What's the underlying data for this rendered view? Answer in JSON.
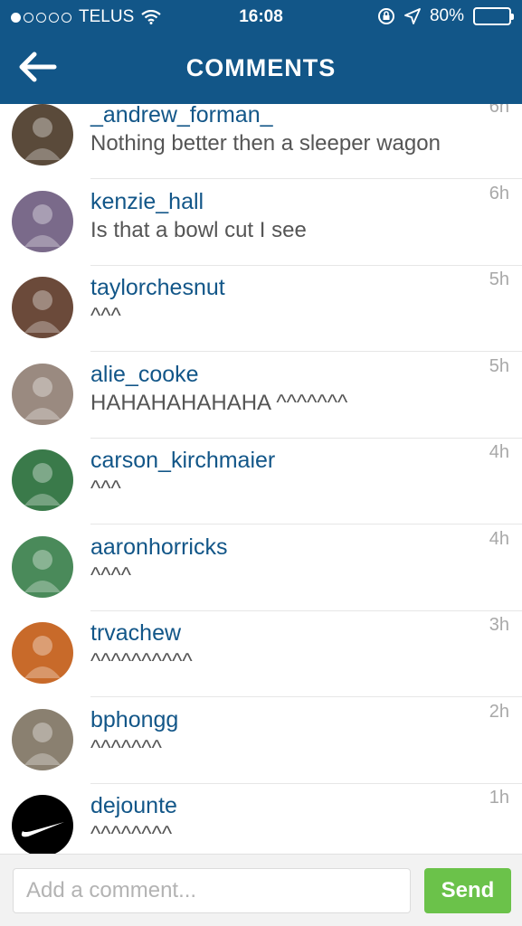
{
  "status_bar": {
    "carrier": "TELUS",
    "time": "16:08",
    "battery": "80%",
    "battery_level": 0.8
  },
  "nav": {
    "title": "COMMENTS",
    "back_icon": "arrow-left-icon"
  },
  "comments": [
    {
      "username": "_andrew_forman_",
      "text": "Nothing better then a sleeper wagon",
      "time": "6h",
      "avatar_color": "#5a4a3a"
    },
    {
      "username": "kenzie_hall",
      "text": "Is that a bowl cut I see",
      "time": "6h",
      "avatar_color": "#7a6a8a"
    },
    {
      "username": "taylorchesnut",
      "text": "^^^",
      "time": "5h",
      "avatar_color": "#6b4a3a"
    },
    {
      "username": "alie_cooke",
      "text": "HAHAHAHAHAHA ^^^^^^^",
      "time": "5h",
      "avatar_color": "#9a8a80"
    },
    {
      "username": "carson_kirchmaier",
      "text": "^^^",
      "time": "4h",
      "avatar_color": "#3a7a4a"
    },
    {
      "username": "aaronhorricks",
      "text": "^^^^",
      "time": "4h",
      "avatar_color": "#4a8a5a"
    },
    {
      "username": "trvachew",
      "text": "^^^^^^^^^^",
      "time": "3h",
      "avatar_color": "#c86a2a"
    },
    {
      "username": "bphongg",
      "text": "^^^^^^^",
      "time": "2h",
      "avatar_color": "#8a8070"
    },
    {
      "username": "dejounte",
      "text": "^^^^^^^^",
      "time": "1h",
      "avatar_color": "#000000"
    }
  ],
  "composer": {
    "placeholder": "Add a comment...",
    "send_label": "Send"
  },
  "colors": {
    "nav_bg": "#125688",
    "username": "#125688",
    "send_bg": "#6bc24a"
  }
}
